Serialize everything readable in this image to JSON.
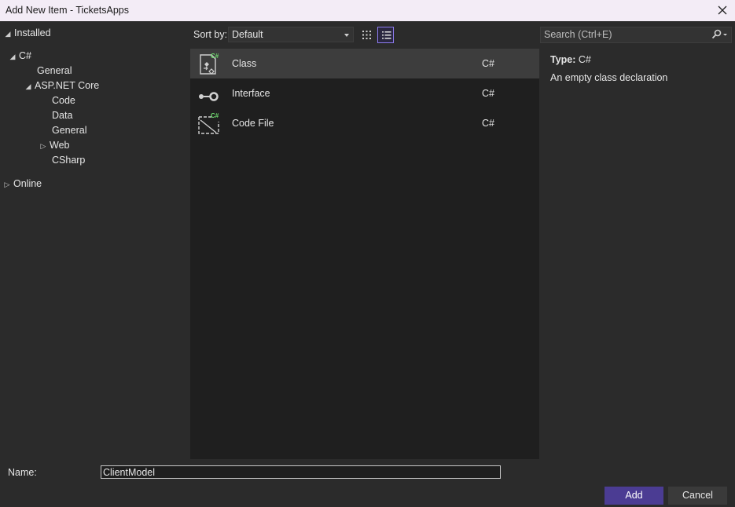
{
  "window": {
    "title": "Add New Item - TicketsApps",
    "close_icon": "close-icon"
  },
  "tree": {
    "installed": "Installed",
    "csharp": "C#",
    "general": "General",
    "aspnet": "ASP.NET Core",
    "code": "Code",
    "data": "Data",
    "general2": "General",
    "web": "Web",
    "csharp2": "CSharp",
    "online": "Online"
  },
  "toolbar": {
    "sort_label": "Sort by:",
    "sort_value": "Default",
    "view_grid_icon": "grid-view-icon",
    "view_list_icon": "list-view-icon"
  },
  "search": {
    "placeholder": "Search (Ctrl+E)"
  },
  "templates": [
    {
      "name": "Class",
      "lang": "C#",
      "icon": "class-icon",
      "selected": true
    },
    {
      "name": "Interface",
      "lang": "C#",
      "icon": "interface-icon",
      "selected": false
    },
    {
      "name": "Code File",
      "lang": "C#",
      "icon": "code-file-icon",
      "selected": false
    }
  ],
  "details": {
    "type_label": "Type:",
    "type_value": "C#",
    "description": "An empty class declaration"
  },
  "footer": {
    "name_label": "Name:",
    "name_value": "ClientModel",
    "add_label": "Add",
    "cancel_label": "Cancel"
  },
  "colors": {
    "accent": "#4b3c93",
    "selection": "#3d3d3d",
    "badge": "#6fdc6f"
  }
}
